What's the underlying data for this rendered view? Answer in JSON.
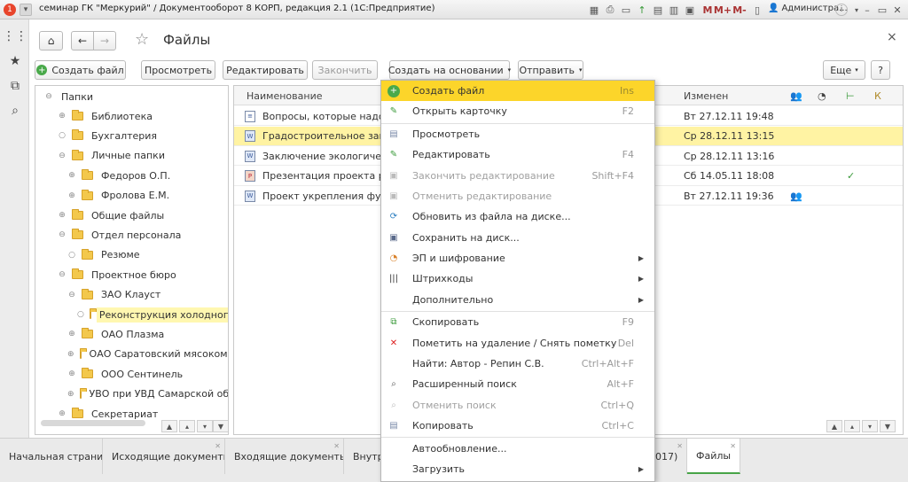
{
  "window": {
    "title": "семинар ГК \"Меркурий\" / Документооборот 8 КОРП, редакция 2.1  (1С:Предприятие)",
    "toolbar_m": "M",
    "toolbar_mplus": "M+",
    "toolbar_mminus": "M-",
    "user": "Администра...",
    "info": "i"
  },
  "page": {
    "title": "Файлы",
    "close": "×"
  },
  "nav": {
    "home_icon": "home-icon",
    "back": "←",
    "forward": "→",
    "star": "☆"
  },
  "toolbar": {
    "create_file": "Создать файл",
    "view": "Просмотреть",
    "edit": "Редактировать",
    "finish": "Закончить",
    "create_based": "Создать на основании",
    "send": "Отправить",
    "more": "Еще",
    "help": "?"
  },
  "tree": {
    "root": "Папки",
    "items": [
      {
        "label": "Библиотека",
        "toggle": "⊕"
      },
      {
        "label": "Бухгалтерия",
        "toggle": "○"
      },
      {
        "label": "Личные папки",
        "toggle": "⊖"
      },
      {
        "label": "Федоров О.П.",
        "toggle": "⊕"
      },
      {
        "label": "Фролова Е.М.",
        "toggle": "⊕"
      },
      {
        "label": "Общие файлы",
        "toggle": "⊕"
      },
      {
        "label": "Отдел персонала",
        "toggle": "⊖"
      },
      {
        "label": "Резюме",
        "toggle": "○"
      },
      {
        "label": "Проектное бюро",
        "toggle": "⊖"
      },
      {
        "label": "ЗАО Клауст",
        "toggle": "⊖"
      },
      {
        "label": "Реконструкция холодного ск",
        "toggle": "○"
      },
      {
        "label": "ОАО Плазма",
        "toggle": "⊕"
      },
      {
        "label": "ОАО Саратовский мясокомбин",
        "toggle": "⊕"
      },
      {
        "label": "ООО Сентинель",
        "toggle": "⊕"
      },
      {
        "label": "УВО при УВД Самарской облас",
        "toggle": "⊕"
      },
      {
        "label": "Секретариат",
        "toggle": "⊕"
      }
    ]
  },
  "list": {
    "col_name": "Наименование",
    "col_changed": "Изменен",
    "col_k": "К",
    "rows": [
      {
        "name": "Вопросы, которые надо об",
        "changed": "Вт 27.12.11 19:48",
        "mark": ""
      },
      {
        "name": "Градостроительное заключ",
        "changed": "Ср 28.12.11 13:15",
        "mark": ""
      },
      {
        "name": "Заключение экологической",
        "changed": "Ср 28.12.11 13:16",
        "mark": ""
      },
      {
        "name": "Презентация проекта реко",
        "changed": "Сб 14.05.11 18:08",
        "mark": "✓"
      },
      {
        "name": "Проект укрепления фундам",
        "changed": "Вт 27.12.11 19:36",
        "mark": ""
      }
    ]
  },
  "menu": {
    "items": [
      {
        "label": "Создать файл",
        "shortcut": "Ins",
        "icon": "plus-icon"
      },
      {
        "label": "Открыть карточку",
        "shortcut": "F2",
        "icon": "pencil-icon"
      },
      {
        "label": "Просмотреть",
        "shortcut": "",
        "icon": "document-icon"
      },
      {
        "label": "Редактировать",
        "shortcut": "F4",
        "icon": "edit-document-icon"
      },
      {
        "label": "Закончить редактирование",
        "shortcut": "Shift+F4",
        "icon": "finish-edit-icon"
      },
      {
        "label": "Отменить редактирование",
        "shortcut": "",
        "icon": "cancel-edit-icon"
      },
      {
        "label": "Обновить из файла на диске...",
        "shortcut": "",
        "icon": "refresh-file-icon"
      },
      {
        "label": "Сохранить на диск...",
        "shortcut": "",
        "icon": "save-disk-icon"
      },
      {
        "label": "ЭП и шифрование",
        "shortcut": "",
        "icon": "signature-icon"
      },
      {
        "label": "Штрихкоды",
        "shortcut": "",
        "icon": "barcode-icon"
      },
      {
        "label": "Дополнительно",
        "shortcut": "",
        "icon": ""
      },
      {
        "label": "Скопировать",
        "shortcut": "F9",
        "icon": "copy-icon"
      },
      {
        "label": "Пометить на удаление / Снять пометку",
        "shortcut": "Del",
        "icon": "delete-mark-icon"
      },
      {
        "label": "Найти: Автор - Репин С.В.",
        "shortcut": "Ctrl+Alt+F",
        "icon": ""
      },
      {
        "label": "Расширенный поиск",
        "shortcut": "Alt+F",
        "icon": "search-icon"
      },
      {
        "label": "Отменить поиск",
        "shortcut": "Ctrl+Q",
        "icon": "cancel-search-icon"
      },
      {
        "label": "Копировать",
        "shortcut": "Ctrl+C",
        "icon": "clipboard-icon"
      },
      {
        "label": "Автообновление...",
        "shortcut": "",
        "icon": ""
      },
      {
        "label": "Загрузить",
        "shortcut": "",
        "icon": ""
      }
    ]
  },
  "tabs": [
    {
      "label": "Начальная страница"
    },
    {
      "label": "Исходящие документы"
    },
    {
      "label": "Входящие документы"
    },
    {
      "label": "Внутре"
    },
    {
      "label": "017)"
    },
    {
      "label": "Файлы"
    }
  ],
  "colors": {
    "highlight": "#fcd52a",
    "selected_row": "#fff3a3",
    "active_tab_underline": "#47a447"
  }
}
